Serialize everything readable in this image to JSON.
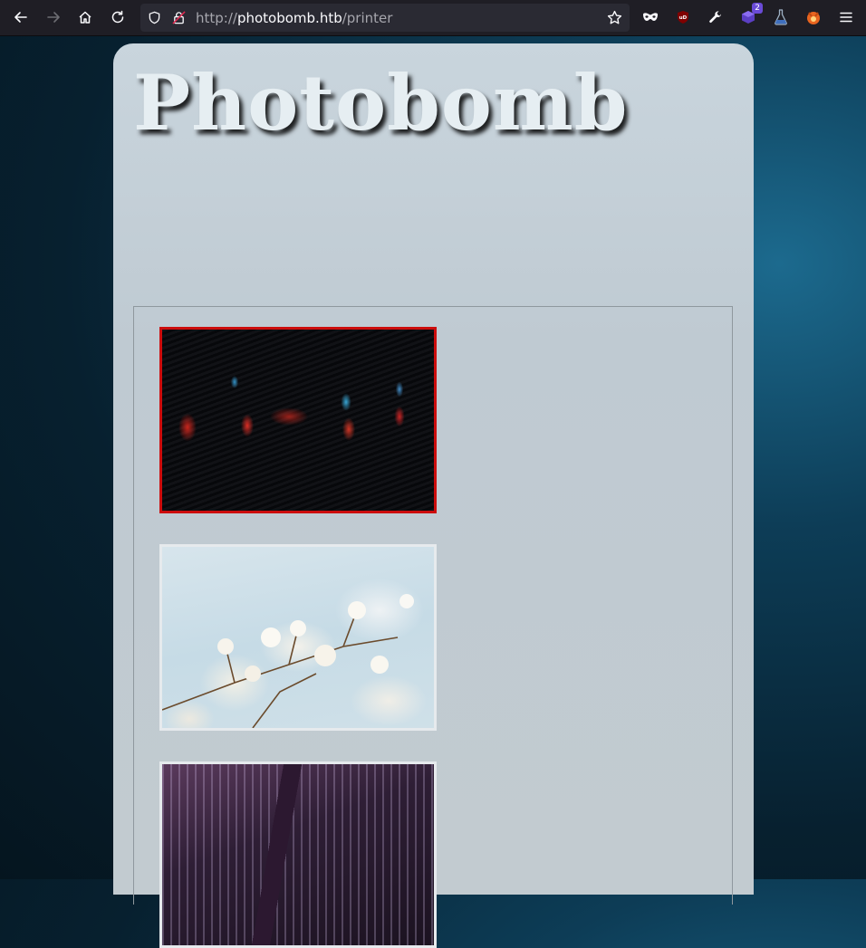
{
  "browser": {
    "url_scheme": "http://",
    "url_host": "photobomb.htb",
    "url_path": "/printer",
    "extension_badge": "2"
  },
  "page": {
    "title": "Photobomb"
  },
  "gallery": {
    "photos": [
      {
        "subject": "dark blinds with red and blue light reflections",
        "selected": true
      },
      {
        "subject": "white blossoms against pale sky",
        "selected": false
      },
      {
        "subject": "city skyscrapers from below at night",
        "selected": false
      }
    ]
  },
  "colors": {
    "selection_border": "#cc0c0c",
    "toolbar_bg": "#1f1e25",
    "card_bg": "#c5d0d7"
  }
}
